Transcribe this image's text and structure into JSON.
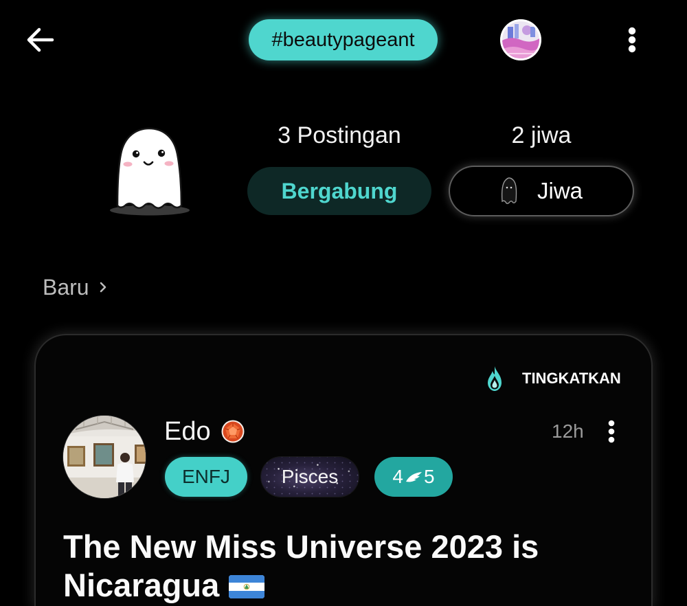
{
  "colors": {
    "background": "#000000",
    "accent_teal": "#4fd6ce",
    "tag_teal": "#44d0c8",
    "badge_teal": "#23a7a0",
    "join_bg": "#0e2826",
    "text": "#f2f2f2",
    "muted_text": "#bdbdbd",
    "secondary_text": "#9b9b9b"
  },
  "top_bar": {
    "back_icon": "arrow-left-icon",
    "hashtag": "#beautypageant",
    "community_avatar": "community-avatar-image",
    "menu_icon": "more-vertical-icon"
  },
  "profile": {
    "mascot_icon": "ghost-mascot-icon",
    "posts_count": "3 Postingan",
    "souls_count": "2 jiwa",
    "join_button": "Bergabung",
    "souls_button": {
      "icon": "ghost-icon",
      "label": "Jiwa"
    }
  },
  "feed": {
    "sort_label": "Baru",
    "sort_icon": "chevron-right-icon"
  },
  "post": {
    "boost": {
      "icon": "flame-icon",
      "label": "TINGKATKAN"
    },
    "author": {
      "name": "Edo",
      "avatar": "author-avatar-photo",
      "badge_icon": "gem-badge-icon"
    },
    "time": "12h",
    "menu_icon": "more-vertical-icon",
    "tags": [
      {
        "label": "ENFJ"
      },
      {
        "label": "Pisces"
      }
    ],
    "wing_badge": {
      "left": "4",
      "icon": "wing-icon",
      "right": "5"
    },
    "title": "The New Miss Universe 2023 is Nicaragua",
    "title_flag_icon": "nicaragua-flag-icon"
  }
}
